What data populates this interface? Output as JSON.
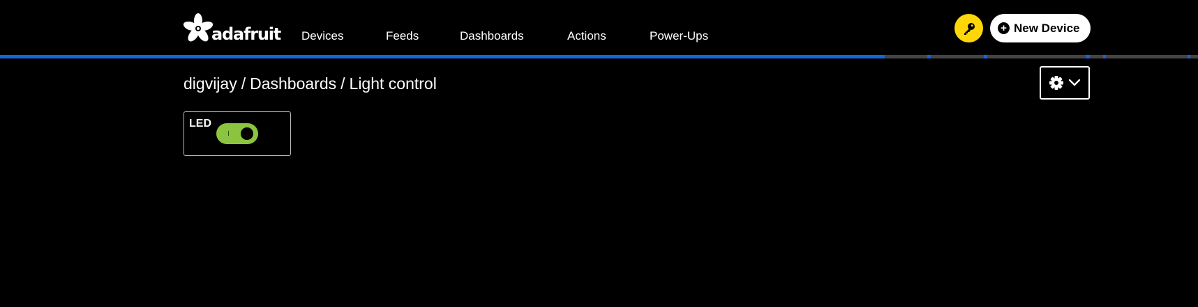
{
  "brand": {
    "name": "adafruit",
    "logo_icon": "adafruit-flower-logo"
  },
  "nav": {
    "items": [
      {
        "label": "Devices"
      },
      {
        "label": "Feeds"
      },
      {
        "label": "Dashboards"
      },
      {
        "label": "Actions"
      },
      {
        "label": "Power-Ups"
      }
    ]
  },
  "header_actions": {
    "key_icon": "key-icon",
    "key_color": "#ffd60a",
    "new_device_label": "New Device",
    "new_device_icon": "plus-circle-icon"
  },
  "accent": {
    "color": "#1565d8",
    "track_color": "#444444"
  },
  "breadcrumb": {
    "user": "digvijay",
    "section": "Dashboards",
    "page": "Light control",
    "separator": "/"
  },
  "settings": {
    "icon": "gear-icon",
    "dropdown_icon": "chevron-down-icon"
  },
  "blocks": [
    {
      "title": "LED",
      "type": "toggle",
      "state": "on",
      "on_color": "#8bc53f"
    }
  ]
}
